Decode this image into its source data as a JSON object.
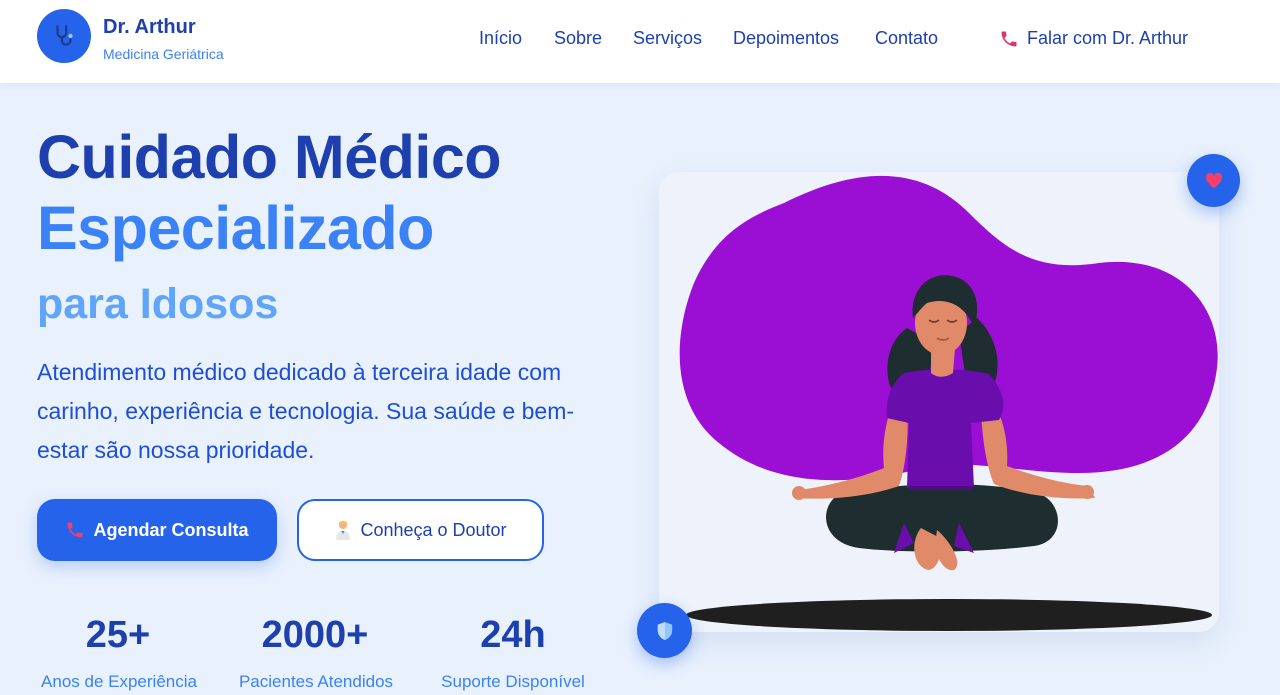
{
  "header": {
    "brand_name": "Dr. Arthur",
    "brand_subtitle": "Medicina Geriátrica",
    "logo_icon": "stethoscope-icon",
    "nav": [
      {
        "label": "Início"
      },
      {
        "label": "Sobre"
      },
      {
        "label": "Serviços"
      },
      {
        "label": "Depoimentos"
      },
      {
        "label": "Contato"
      }
    ],
    "cta_label": "Falar com Dr. Arthur",
    "cta_icon": "phone-icon"
  },
  "hero": {
    "title_line1": "Cuidado Médico",
    "title_line2": "Especializado",
    "title_line3": "para Idosos",
    "description": "Atendimento médico dedicado à terceira idade com carinho, experiência e tecnologia. Sua saúde e bem-estar são nossa prioridade.",
    "primary_button": "Agendar Consulta",
    "primary_icon": "phone-icon",
    "secondary_button": "Conheça o Doutor",
    "secondary_icon": "doctor-icon"
  },
  "stats": [
    {
      "value": "25+",
      "label": "Anos de Experiência"
    },
    {
      "value": "2000+",
      "label": "Pacientes Atendidos"
    },
    {
      "value": "24h",
      "label": "Suporte Disponível"
    }
  ],
  "illustration": {
    "subject": "woman-meditating-illustration",
    "badge_top_icon": "heart-icon",
    "badge_bottom_icon": "shield-icon"
  },
  "colors": {
    "primary": "#2563eb",
    "dark_blue": "#1e40af",
    "mid_blue": "#3b82f6",
    "light_blue": "#60a5fa",
    "background": "#e9f1fd",
    "blob_purple": "#9b0fd4",
    "phone_pink": "#e0336b"
  }
}
